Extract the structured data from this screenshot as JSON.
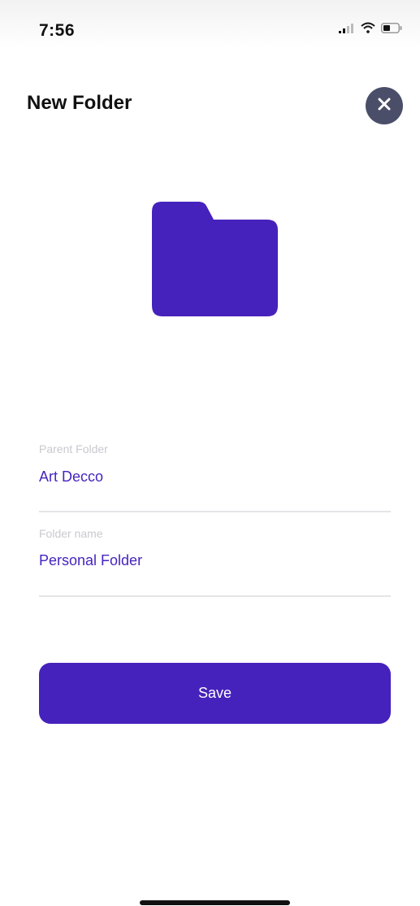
{
  "status_bar": {
    "time": "7:56",
    "icons": [
      "signal-icon",
      "wifi-icon",
      "battery-icon"
    ]
  },
  "header": {
    "title": "New Folder",
    "close_icon": "close-icon"
  },
  "folder_icon": "folder-icon",
  "form": {
    "parent_folder": {
      "label": "Parent Folder",
      "value": "Art Decco"
    },
    "folder_name": {
      "label": "Folder name",
      "value": "Personal Folder"
    }
  },
  "save_button": {
    "label": "Save"
  },
  "colors": {
    "accent": "#4622bc",
    "close_bg": "#4a4e68",
    "label_gray": "#c9c9cf",
    "divider": "#e5e5e8"
  }
}
